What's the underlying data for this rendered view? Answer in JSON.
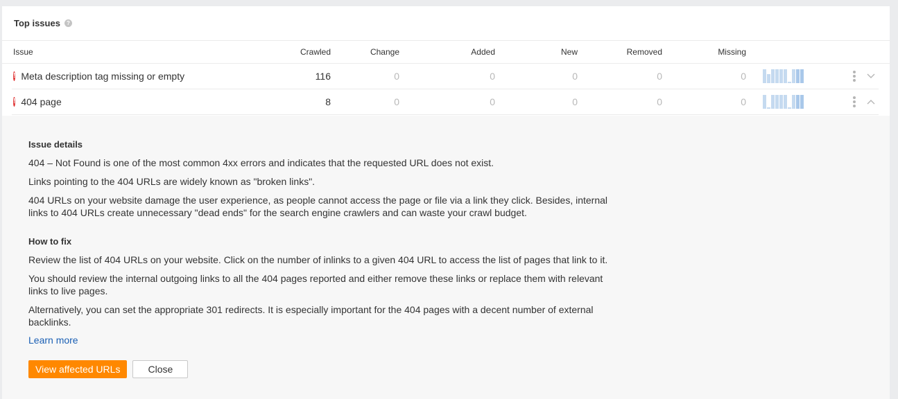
{
  "panel": {
    "title": "Top issues",
    "help_icon": "?"
  },
  "table": {
    "columns": [
      "Issue",
      "Crawled",
      "Change",
      "Added",
      "New",
      "Removed",
      "Missing"
    ],
    "rows": [
      {
        "issue": "Meta description tag missing or empty",
        "severity": "error",
        "crawled": "116",
        "change": "0",
        "added": "0",
        "new": "0",
        "removed": "0",
        "missing": "0",
        "trend": [
          1,
          0.65,
          1,
          1,
          1,
          1,
          0.1,
          1,
          1,
          1
        ],
        "expanded": false
      },
      {
        "issue": "404 page",
        "severity": "error",
        "crawled": "8",
        "change": "0",
        "added": "0",
        "new": "0",
        "removed": "0",
        "missing": "0",
        "trend": [
          1,
          0.1,
          1,
          1,
          1,
          1,
          0.1,
          1,
          1,
          1
        ],
        "expanded": true
      }
    ]
  },
  "details": {
    "issue_heading": "Issue details",
    "issue_paragraphs": [
      "404 – Not Found is one of the most common 4xx errors and indicates that the requested URL does not exist.",
      "Links pointing to the 404 URLs are widely known as \"broken links\".",
      "404 URLs on your website damage the user experience, as people cannot access the page or file via a link they click. Besides, internal links to 404 URLs create unnecessary \"dead ends\" for the search engine crawlers and can waste your crawl budget."
    ],
    "fix_heading": "How to fix",
    "fix_paragraphs": [
      "Review the list of 404 URLs on your website. Click on the number of inlinks to a given 404 URL to access the list of pages that link to it.",
      "You should review the internal outgoing links to all the 404 pages reported and either remove these links or replace them with relevant links to live pages.",
      "Alternatively, you can set the appropriate 301 redirects. It is especially important for the 404 pages with a decent number of external backlinks."
    ],
    "learn_more": "Learn more",
    "view_button": "View affected URLs",
    "close_button": "Close"
  },
  "colors": {
    "accent": "#ff8800",
    "error": "#e03131",
    "link": "#1a5fb4",
    "sparkline": "#c5daf0"
  }
}
